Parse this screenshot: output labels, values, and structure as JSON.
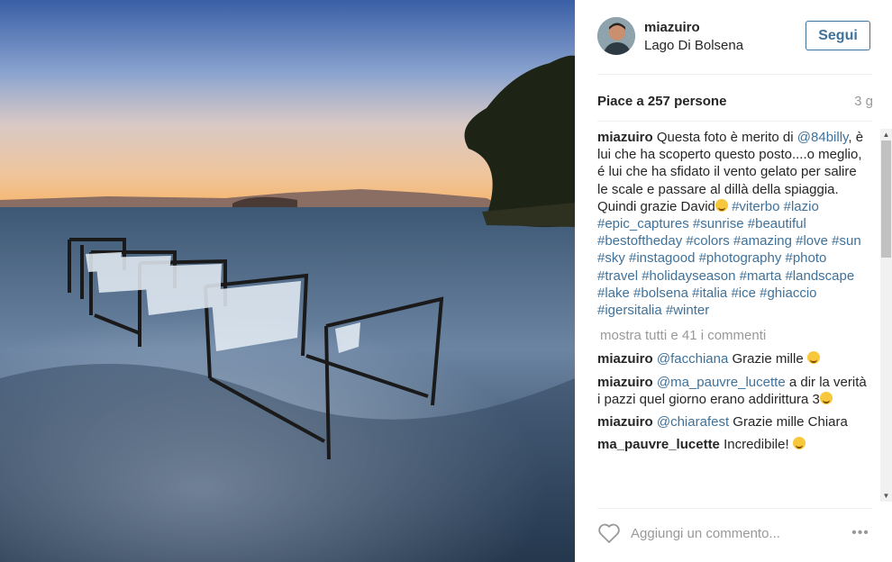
{
  "post": {
    "username": "miazuiro",
    "location": "Lago Di Bolsena",
    "follow_label": "Segui",
    "likes": "Piace a 257 persone",
    "age": "3 g"
  },
  "caption": {
    "username": "miazuiro",
    "text_1": "Questa foto è merito di",
    "mention": "@84billy",
    "text_2": ", è lui che ha scoperto questo posto....o meglio, é lui che ha sfidato il vento gelato per salire le scale e passare al dillà della spiaggia. Quindi grazie David",
    "hashtags": "#viterbo #lazio #epic_captures #sunrise #beautiful #bestoftheday #colors #amazing #love #sun #sky #instagood #photography #photo #travel #holidayseason #marta #landscape #lake #bolsena #italia #ice #ghiaccio #igersitalia #winter"
  },
  "show_more": "mostra tutti e 41 i commenti",
  "comments": [
    {
      "username": "miazuiro",
      "mention": "@facchiana",
      "text": "Grazie mille"
    },
    {
      "username": "miazuiro",
      "mention": "@ma_pauvre_lucette",
      "text": "a dir la verità i pazzi quel giorno erano addirittura 3"
    },
    {
      "username": "miazuiro",
      "mention": "@chiarafest",
      "text": "Grazie mille Chiara"
    },
    {
      "username": "ma_pauvre_lucette",
      "mention": "",
      "text": "Incredibile!"
    }
  ],
  "input": {
    "placeholder": "Aggiungi un commento..."
  },
  "more_options": "•••",
  "colors": {
    "link": "#3f729b",
    "muted": "#999999",
    "text": "#262626"
  },
  "icons": {
    "like": "heart-icon",
    "options": "more-options-icon"
  }
}
